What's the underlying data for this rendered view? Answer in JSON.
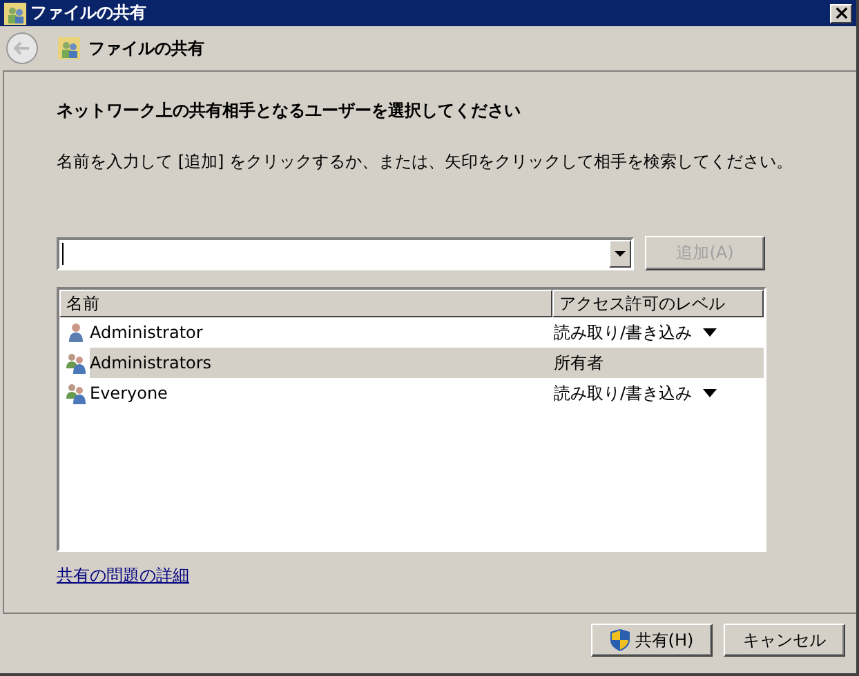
{
  "window": {
    "title": "ファイルの共有"
  },
  "nav": {
    "title": "ファイルの共有"
  },
  "heading": "ネットワーク上の共有相手となるユーザーを選択してください",
  "instruction": "名前を入力して [追加] をクリックするか、または、矢印をクリックして相手を検索してください。",
  "add_button": {
    "label": "追加(A)",
    "disabled": true
  },
  "table": {
    "columns": [
      "名前",
      "アクセス許可のレベル"
    ],
    "rows": [
      {
        "kind": "user",
        "name": "Administrator",
        "level": "読み取り/書き込み",
        "has_dropdown": true,
        "selected": false
      },
      {
        "kind": "group",
        "name": "Administrators",
        "level": "所有者",
        "has_dropdown": false,
        "selected": true
      },
      {
        "kind": "group",
        "name": "Everyone",
        "level": "読み取り/書き込み",
        "has_dropdown": true,
        "selected": false
      }
    ]
  },
  "help_link": "共有の問題の詳細",
  "buttons": [
    {
      "kind": "shield",
      "label": "共有(H)"
    },
    {
      "kind": "plain",
      "label": "キャンセル"
    }
  ]
}
